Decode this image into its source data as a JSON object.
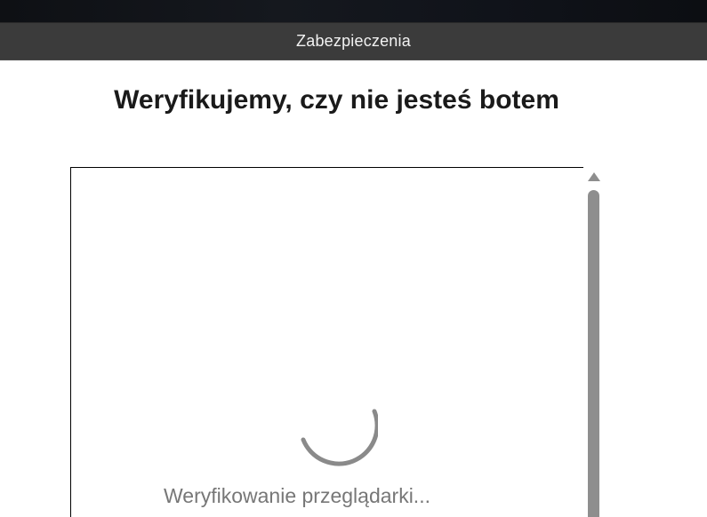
{
  "window": {
    "title": "Zabezpieczenia"
  },
  "page": {
    "heading": "Weryfikujemy, czy nie jesteś botem"
  },
  "challenge": {
    "status": "Weryfikowanie przeglądarki...",
    "spinner_icon": "loading-spinner-icon"
  },
  "colors": {
    "title_bar": "#3b3b3b",
    "heading": "#1a1a1a",
    "status_text": "#777777",
    "scrollbar": "#8e8e8e"
  }
}
